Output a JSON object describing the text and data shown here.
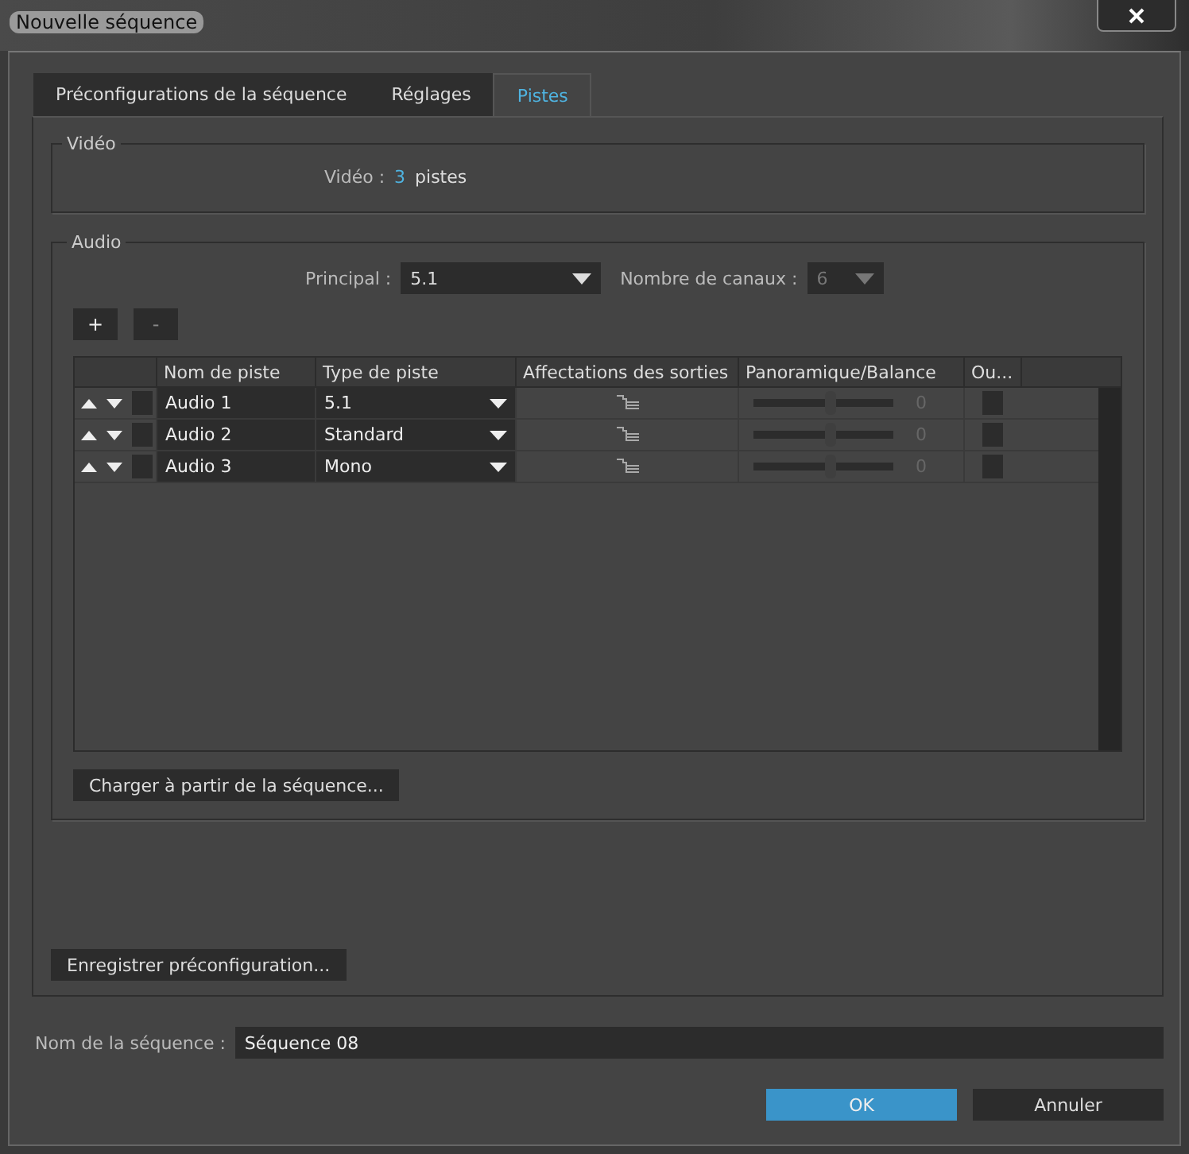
{
  "window": {
    "title": "Nouvelle séquence"
  },
  "tabs": [
    {
      "label": "Préconfigurations de la séquence",
      "selected": false
    },
    {
      "label": "Réglages",
      "selected": false
    },
    {
      "label": "Pistes",
      "selected": true
    }
  ],
  "video": {
    "legend": "Vidéo",
    "label": "Vidéo :",
    "count": "3",
    "unit": "pistes"
  },
  "audio": {
    "legend": "Audio",
    "master_label": "Principal :",
    "master_value": "5.1",
    "channels_label": "Nombre de canaux :",
    "channels_value": "6",
    "add_button": "+",
    "remove_button": "-",
    "table": {
      "columns": [
        "Nom de piste",
        "Type de piste",
        "Affectations des sorties",
        "Panoramique/Balance",
        "Ou..."
      ],
      "rows": [
        {
          "checked": false,
          "name": "Audio 1",
          "type": "5.1",
          "level": 0.5,
          "pan": "0",
          "out_checked": false
        },
        {
          "checked": false,
          "name": "Audio 2",
          "type": "Standard",
          "level": 0.5,
          "pan": "0",
          "out_checked": false
        },
        {
          "checked": false,
          "name": "Audio 3",
          "type": "Mono",
          "level": 0.5,
          "pan": "0",
          "out_checked": false
        }
      ]
    },
    "load_button": "Charger à partir de la séquence..."
  },
  "save_preset_button": "Enregistrer préconfiguration...",
  "sequence_name": {
    "label": "Nom de la séquence :",
    "value": "Séquence 08"
  },
  "buttons": [
    {
      "label": "OK",
      "kind": "primary"
    },
    {
      "label": "Annuler",
      "kind": "secondary"
    }
  ]
}
